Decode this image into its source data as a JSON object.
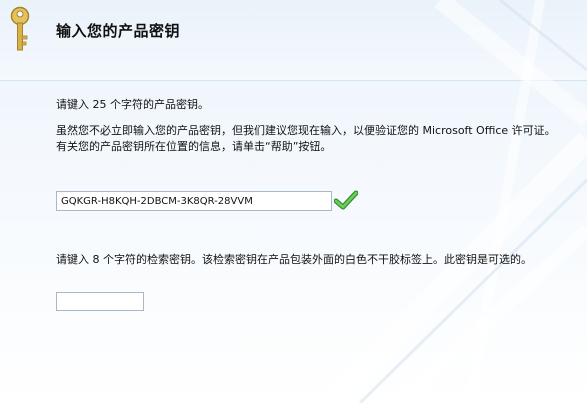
{
  "window": {
    "title": "输入您的产品密钥"
  },
  "icons": {
    "header": "key-icon",
    "validation": "checkmark-icon"
  },
  "colors": {
    "check_green": "#3aa33a",
    "key_gold": "#d9b24a",
    "background_top": "#e9f3fb"
  },
  "product_key": {
    "instruction": "请键入 25 个字符的产品密钥。",
    "note": "虽然您不必立即输入您的产品密钥，但我们建议您现在输入，以便验证您的 Microsoft Office 许可证。有关您的产品密钥所在位置的信息，请单击“帮助”按钮。",
    "value": "GQKGR-H8KQH-2DBCM-3K8QR-28VVM"
  },
  "search_key": {
    "instruction": "请键入 8 个字符的检索密钥。该检索密钥在产品包装外面的白色不干胶标签上。此密钥是可选的。",
    "value": ""
  }
}
